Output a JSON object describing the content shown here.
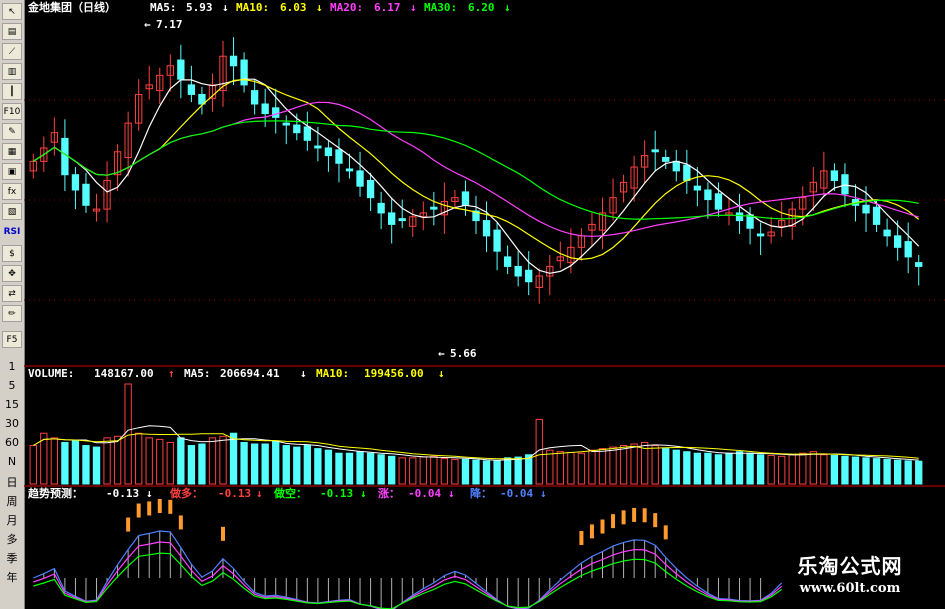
{
  "toolbar": {
    "icons": [
      {
        "name": "cursor-icon",
        "glyph": "↖"
      },
      {
        "name": "fenshi-icon",
        "glyph": "▤"
      },
      {
        "name": "line-chart-icon",
        "glyph": "⟋"
      },
      {
        "name": "bar-chart-icon",
        "glyph": "▥"
      },
      {
        "name": "candle-icon",
        "glyph": "┃"
      },
      {
        "name": "f10-icon",
        "glyph": "F10"
      },
      {
        "name": "note-icon",
        "glyph": "✎"
      },
      {
        "name": "table-icon",
        "glyph": "▦"
      },
      {
        "name": "calc-icon",
        "glyph": "▣"
      },
      {
        "name": "fx-icon",
        "glyph": "fx"
      },
      {
        "name": "chart2-icon",
        "glyph": "▧"
      }
    ],
    "rsi": "RSI",
    "icons2": [
      {
        "name": "money-icon",
        "glyph": "$"
      },
      {
        "name": "move-icon",
        "glyph": "✥"
      },
      {
        "name": "export-icon",
        "glyph": "⇄"
      },
      {
        "name": "pencil-icon",
        "glyph": "✏"
      }
    ],
    "f5": "F5",
    "periods": [
      "1",
      "5",
      "15",
      "30",
      "60",
      "N",
      "日",
      "周",
      "月",
      "多",
      "季",
      "年"
    ]
  },
  "header": {
    "title": "金地集团（日线）",
    "ma5_label": "MA5:",
    "ma5_value": "5.93",
    "ma10_label": "MA10:",
    "ma10_value": "6.03",
    "ma20_label": "MA20:",
    "ma20_value": "6.17",
    "ma30_label": "MA30:",
    "ma30_value": "6.20",
    "down_arrow": "↓",
    "up_arrow": "↑"
  },
  "volume_header": {
    "label": "VOLUME:",
    "value": "148167.00",
    "ma5_label": "MA5:",
    "ma5_value": "206694.41",
    "ma10_label": "MA10:",
    "ma10_value": "199456.00"
  },
  "indicator_header": {
    "label": "趋势预测：",
    "value": "-0.13",
    "duo_label": "做多：",
    "duo_value": "-0.13",
    "kong_label": "做空：",
    "kong_value": "-0.13",
    "zhang_label": "涨：",
    "zhang_value": "-0.04",
    "jiang_label": "降：",
    "jiang_value": "-0.04"
  },
  "annotations": {
    "high": "7.17",
    "low": "5.66",
    "high_arrow": "←",
    "low_arrow": "←"
  },
  "brand": {
    "name": "乐淘公式网",
    "url": "www.60lt.com"
  },
  "colors": {
    "background": "#000000",
    "rise": "#ff4040",
    "fall": "#54ffff",
    "ma5": "#ffffff",
    "ma10": "#ffff00",
    "ma20": "#ff40ff",
    "ma30": "#00ff00",
    "divider": "#8b0000",
    "grid": "#800000",
    "orange": "#ff9a2e"
  },
  "chart_data": {
    "type": "candlestick",
    "title": "金地集团（日线）",
    "annotated_high": 7.17,
    "annotated_low": 5.66,
    "ylim": [
      5.5,
      7.3
    ],
    "closes": [
      6.55,
      6.62,
      6.7,
      6.48,
      6.4,
      6.32,
      6.3,
      6.45,
      6.6,
      6.75,
      6.9,
      6.95,
      7.0,
      7.05,
      6.98,
      6.9,
      6.85,
      6.95,
      7.1,
      7.05,
      6.95,
      6.85,
      6.8,
      6.78,
      6.74,
      6.7,
      6.66,
      6.62,
      6.58,
      6.54,
      6.5,
      6.42,
      6.36,
      6.28,
      6.22,
      6.24,
      6.26,
      6.28,
      6.3,
      6.34,
      6.36,
      6.32,
      6.24,
      6.16,
      6.08,
      6.0,
      5.95,
      5.92,
      5.95,
      6.0,
      6.05,
      6.1,
      6.16,
      6.22,
      6.28,
      6.36,
      6.44,
      6.52,
      6.58,
      6.6,
      6.55,
      6.5,
      6.45,
      6.4,
      6.35,
      6.3,
      6.28,
      6.24,
      6.2,
      6.16,
      6.18,
      6.24,
      6.3,
      6.36,
      6.44,
      6.5,
      6.45,
      6.38,
      6.32,
      6.28,
      6.22,
      6.16,
      6.1,
      6.05,
      6.0
    ],
    "ma5_value": 5.93,
    "ma10_value": 6.03,
    "ma20_value": 6.17,
    "ma30_value": 6.2,
    "volume": {
      "current": 148167.0,
      "ma5": 206694.41,
      "ma10": 199456.0,
      "values": [
        250000,
        330000,
        300000,
        270000,
        280000,
        250000,
        240000,
        300000,
        310000,
        650000,
        330000,
        300000,
        290000,
        270000,
        300000,
        250000,
        260000,
        300000,
        310000,
        330000,
        270000,
        260000,
        260000,
        280000,
        250000,
        240000,
        250000,
        230000,
        220000,
        200000,
        200000,
        210000,
        200000,
        190000,
        180000,
        170000,
        170000,
        175000,
        180000,
        165000,
        160000,
        160000,
        155000,
        150000,
        150000,
        170000,
        175000,
        190000,
        420000,
        220000,
        210000,
        205000,
        200000,
        220000,
        230000,
        240000,
        250000,
        260000,
        270000,
        250000,
        230000,
        220000,
        210000,
        200000,
        200000,
        190000,
        200000,
        210000,
        200000,
        190000,
        185000,
        180000,
        190000,
        200000,
        210000,
        190000,
        185000,
        180000,
        175000,
        170000,
        165000,
        160000,
        155000,
        150000,
        148167
      ],
      "axis_labels": [
        "1",
        "5",
        "15",
        "30",
        "60",
        "N"
      ]
    },
    "indicator": {
      "name": "趋势预测",
      "value": -0.13,
      "duo": -0.13,
      "kong": -0.13,
      "zhang": -0.04,
      "jiang": -0.04
    }
  }
}
